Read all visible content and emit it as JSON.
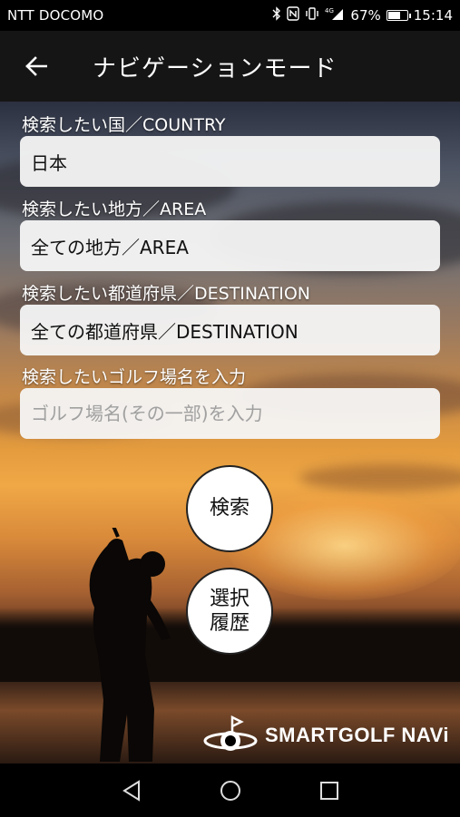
{
  "status_bar": {
    "carrier": "NTT DOCOMO",
    "battery_percent": "67%",
    "battery_level": 0.67,
    "time": "15:14",
    "icons": [
      "bluetooth-icon",
      "nfc-icon",
      "vibrate-icon",
      "4g-signal-icon",
      "battery-icon"
    ]
  },
  "app_bar": {
    "back_icon": "arrow-left-icon",
    "title": "ナビゲーションモード"
  },
  "form": {
    "country": {
      "label": "検索したい国／COUNTRY",
      "value": "日本"
    },
    "area": {
      "label": "検索したい地方／AREA",
      "value": "全ての地方／AREA"
    },
    "destination": {
      "label": "検索したい都道府県／DESTINATION",
      "value": "全ての都道府県／DESTINATION"
    },
    "golf_course": {
      "label": "検索したいゴルフ場名を入力",
      "value": "",
      "placeholder": "ゴルフ場名(その一部)を入力"
    }
  },
  "buttons": {
    "search": "検索",
    "history_line1": "選択",
    "history_line2": "履歴"
  },
  "logo": {
    "text": "SMARTGOLF NAVi"
  },
  "nav_bar": {
    "icons": [
      "back-triangle-icon",
      "home-circle-icon",
      "recents-square-icon"
    ]
  },
  "colors": {
    "app_bar": "#151515",
    "field_bg": "#f5f5f5",
    "accent_sky": "#e29a3e"
  }
}
